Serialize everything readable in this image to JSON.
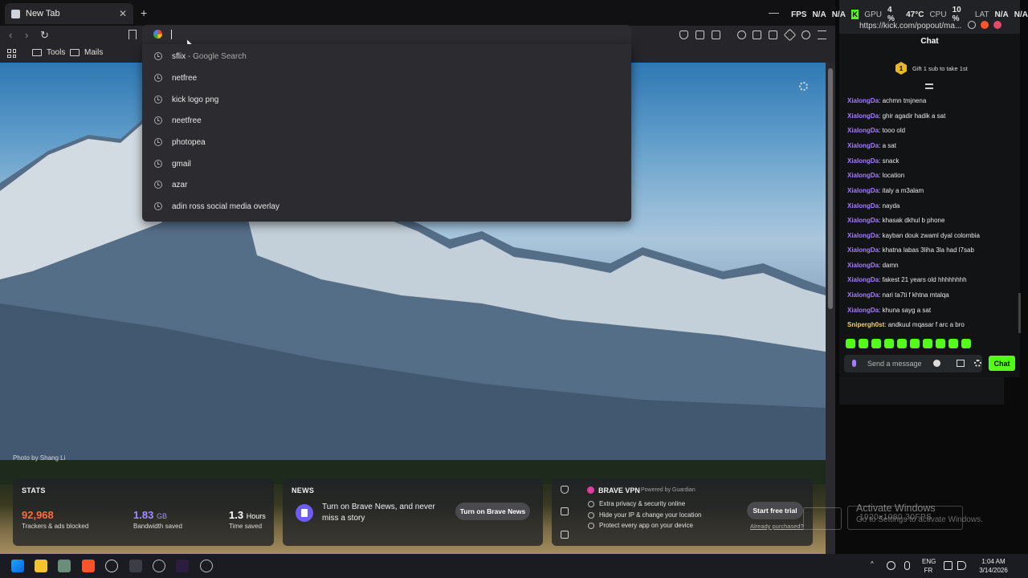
{
  "browser": {
    "tab_title": "New Tab",
    "tab_close": "✕",
    "new_tab": "+",
    "minimize": "—",
    "back": "‹",
    "forward": "›",
    "reload": "↻",
    "address_value": ""
  },
  "bookmarks": [
    {
      "label": "Tools"
    },
    {
      "label": "Mails"
    }
  ],
  "suggestions": [
    {
      "text": "sflix",
      "suffix": " - Google Search"
    },
    {
      "text": "netfree",
      "suffix": ""
    },
    {
      "text": "kick logo png",
      "suffix": ""
    },
    {
      "text": "neetfree",
      "suffix": ""
    },
    {
      "text": "photopea",
      "suffix": ""
    },
    {
      "text": "gmail",
      "suffix": ""
    },
    {
      "text": "azar",
      "suffix": ""
    },
    {
      "text": "adin ross social media overlay",
      "suffix": ""
    }
  ],
  "newtab_page": {
    "photo_credit": "Photo by Shang Li",
    "stats": {
      "title": "STATS",
      "trackers_value": "92,968",
      "trackers_label": "Trackers & ads blocked",
      "bandwidth_value": "1.83",
      "bandwidth_unit": "GB",
      "bandwidth_label": "Bandwidth saved",
      "time_value": "1.3",
      "time_unit": "Hours",
      "time_label": "Time saved"
    },
    "news": {
      "title": "NEWS",
      "text": "Turn on Brave News, and never miss a story",
      "button": "Turn on Brave News"
    },
    "vpn": {
      "title": "BRAVE VPN",
      "powered": "Powered by Guardian",
      "features": [
        "Extra privacy & security online",
        "Hide your IP & change your location",
        "Protect every app on your device"
      ],
      "button": "Start free trial",
      "link": "Already purchased?"
    }
  },
  "osd": {
    "fps_label": "FPS",
    "fps_value": "N/A",
    "fps_value2": "N/A",
    "gpu_label": "GPU",
    "gpu_value": "4 %",
    "gpu_temp": "47°C",
    "cpu_label": "CPU",
    "cpu_value": "10 %",
    "lat_label": "LAT",
    "lat_value": "N/A",
    "lat_value2": "N/A"
  },
  "kick": {
    "url": "https://kick.com/popout/ma...",
    "chat_title": "Chat",
    "sub_badge": "1",
    "sub_text": "Gift 1 sub to take 1st",
    "messages": [
      {
        "user": "XialongDa",
        "text": "achmn tmjnena"
      },
      {
        "user": "XialongDa",
        "text": "ghir agadir hadik a sat"
      },
      {
        "user": "XialongDa",
        "text": "tooo old"
      },
      {
        "user": "XialongDa",
        "text": "a sat"
      },
      {
        "user": "XialongDa",
        "text": "snack"
      },
      {
        "user": "XialongDa",
        "text": "location"
      },
      {
        "user": "XialongDa",
        "text": "italy a m3alam"
      },
      {
        "user": "XialongDa",
        "text": "nayda"
      },
      {
        "user": "XialongDa",
        "text": "khasak dkhul b phone"
      },
      {
        "user": "XialongDa",
        "text": "kayban douk zwaml dyal colombia"
      },
      {
        "user": "XialongDa",
        "text": "khatna labas 3liha 3la had l7sab"
      },
      {
        "user": "XialongDa",
        "text": "damn"
      },
      {
        "user": "XialongDa",
        "text": "fakest 21 years old hhhhhhhh"
      },
      {
        "user": "XialongDa",
        "text": "nari ta7ti f khtna mtalqa"
      },
      {
        "user": "XialongDa",
        "text": "khuna sayg a sat"
      },
      {
        "user": "Snipergh0st",
        "text": "andkuul mqasar f arc a bro"
      }
    ],
    "input_placeholder": "Send a message",
    "chat_button": "Chat"
  },
  "watermark": {
    "line1": "Activate Windows",
    "line2": "Go to Settings to activate Windows.",
    "res": "1920x1080  30FPS"
  },
  "taskbar": {
    "lang1": "ENG",
    "lang2": "FR",
    "time": "1:04 AM",
    "date": "3/14/2026"
  },
  "colors": {
    "kick_green": "#53fc18",
    "username_purple": "#a57bff",
    "stats_trackers": "#ff6b3d",
    "stats_bandwidth": "#a08cff"
  }
}
